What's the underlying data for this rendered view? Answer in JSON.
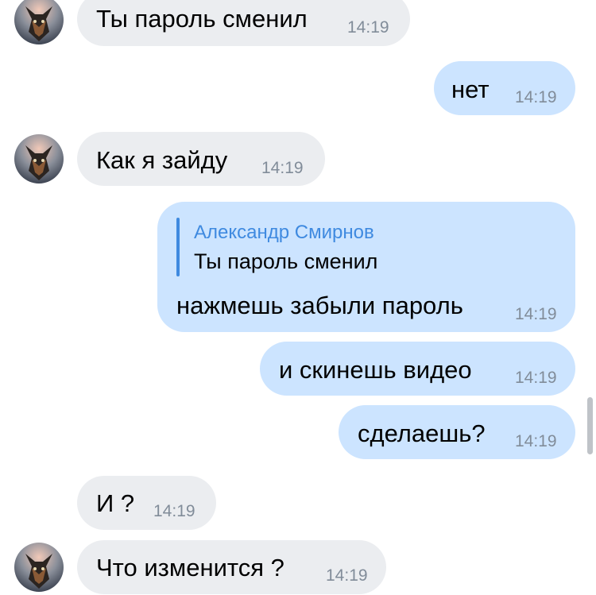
{
  "chat": {
    "messages": [
      {
        "direction": "incoming",
        "text": "Ты пароль сменил",
        "time": "14:19",
        "avatar": true
      },
      {
        "direction": "outgoing",
        "text": "нет",
        "time": "14:19"
      },
      {
        "direction": "incoming",
        "text": "Как я зайду",
        "time": "14:19",
        "avatar": true
      },
      {
        "direction": "outgoing",
        "text": "нажмешь забыли пароль",
        "time": "14:19",
        "reply": {
          "author": "Александр Смирнов",
          "text": "Ты пароль сменил"
        }
      },
      {
        "direction": "outgoing",
        "text": "и скинешь видео",
        "time": "14:19"
      },
      {
        "direction": "outgoing",
        "text": "сделаешь?",
        "time": "14:19"
      },
      {
        "direction": "incoming",
        "text": "И ?",
        "time": "14:19",
        "avatar": false
      },
      {
        "direction": "incoming",
        "text": "Что изменится ?",
        "time": "14:19",
        "avatar": true
      }
    ]
  },
  "colors": {
    "incoming_bubble": "#ebedf0",
    "outgoing_bubble": "#cce4ff",
    "timestamp": "#818c99",
    "reply_accent": "#3f8ae0"
  },
  "icons": {
    "avatar": "dog-avatar-icon"
  }
}
